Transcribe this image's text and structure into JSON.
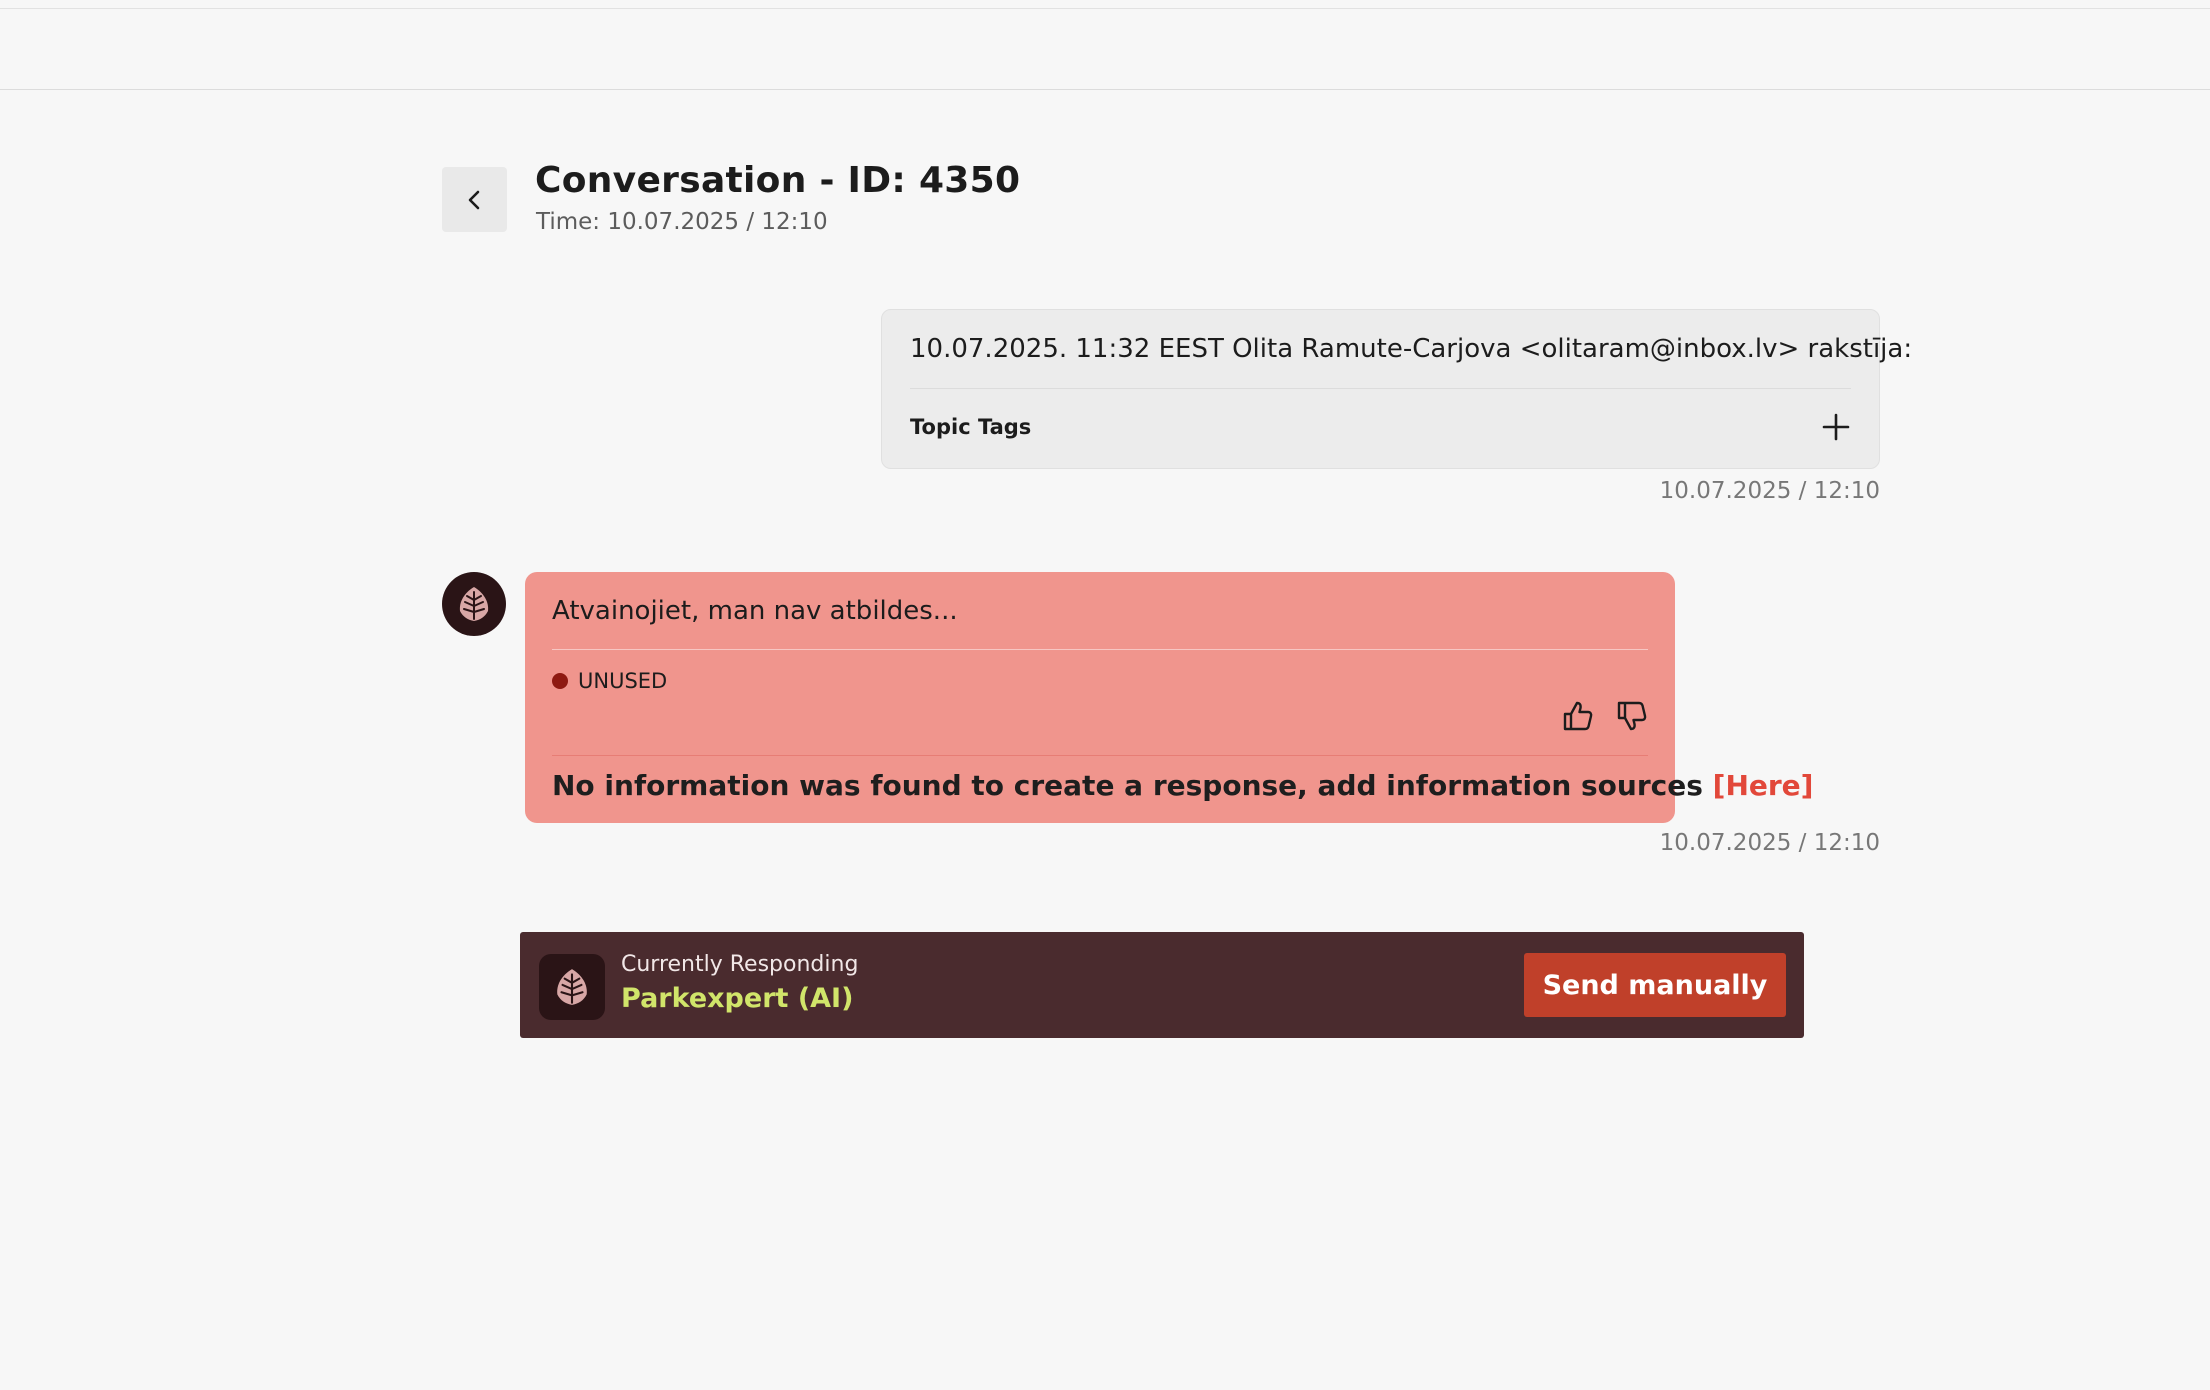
{
  "header": {
    "title": "Conversation - ID: 4350",
    "time": "Time: 10.07.2025 / 12:10",
    "back_icon": "chevron-left-icon"
  },
  "user_message": {
    "text": "10.07.2025. 11:32 EEST Olita Ramute-Carjova <olitaram@inbox.lv> rakstīja:",
    "topic_tags_label": "Topic Tags",
    "add_icon": "plus-icon",
    "timestamp": "10.07.2025 / 12:10"
  },
  "bot_message": {
    "avatar_icon": "leaf-logo-icon",
    "text": "Atvainojiet, man nav atbildes...",
    "status": "UNUSED",
    "status_color": "#8e1a12",
    "thumbs_up_icon": "thumbs-up-icon",
    "thumbs_down_icon": "thumbs-down-icon",
    "info_text": "No information was found to create a response, add information sources",
    "info_link": "[Here]",
    "timestamp": "10.07.2025 / 12:10",
    "bubble_color": "#f0958d"
  },
  "responder": {
    "label": "Currently Responding",
    "name": "Parkexpert (AI)",
    "send_button": "Send manually",
    "bar_color": "#4a2b2e",
    "name_color": "#d1e56a",
    "button_color": "#c0402a"
  }
}
